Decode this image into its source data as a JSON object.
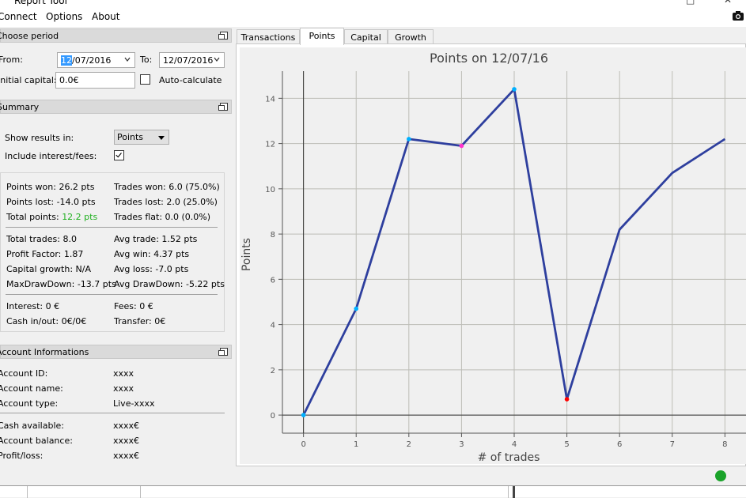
{
  "window": {
    "title": "Report Tool"
  },
  "menu": {
    "items": [
      "Connect",
      "Options",
      "About"
    ]
  },
  "period": {
    "header": "Choose period",
    "from_label": "From:",
    "from_day": "12",
    "from_rest": "/07/2016",
    "to_label": "To:",
    "to_value": "12/07/2016",
    "initial_capital_label": "Initial capital:",
    "initial_capital_value": "0.0€",
    "auto_calculate_label": "Auto-calculate"
  },
  "summary": {
    "header": "Summary",
    "show_results_label": "Show results in:",
    "show_results_value": "Points",
    "include_fees_label": "Include interest/fees:",
    "include_fees_checked": true,
    "rows": {
      "points_won": "Points won: 26.2 pts",
      "trades_won": "Trades won: 6.0 (75.0%)",
      "points_lost": "Points lost: -14.0 pts",
      "trades_lost": "Trades lost: 2.0 (25.0%)",
      "total_points_label": "Total points:",
      "total_points_value": "12.2 pts",
      "trades_flat": "Trades flat: 0.0 (0.0%)",
      "total_trades": "Total trades: 8.0",
      "avg_trade": "Avg trade: 1.52 pts",
      "profit_factor": "Profit Factor: 1.87",
      "avg_win": "Avg win: 4.37 pts",
      "capital_growth": "Capital growth: N/A",
      "avg_loss": "Avg loss: -7.0 pts",
      "max_drawdown": "MaxDrawDown: -13.7 pts",
      "avg_drawdown": "Avg DrawDown: -5.22 pts",
      "interest": "Interest: 0 €",
      "fees": "Fees: 0 €",
      "cash_inout": "Cash in/out: 0€/0€",
      "transfer": "Transfer: 0€"
    }
  },
  "account": {
    "header": "Account Informations",
    "id_label": "Account ID:",
    "id_value": "xxxx",
    "name_label": "Account name:",
    "name_value": "xxxx",
    "type_label": "Account type:",
    "type_value": "Live-xxxx",
    "cash_label": "Cash available:",
    "cash_value": "xxxx€",
    "balance_label": "Account balance:",
    "balance_value": "xxxx€",
    "pl_label": "Profit/loss:",
    "pl_value": "xxxx€"
  },
  "tabs": [
    "Transactions",
    "Points",
    "Capital",
    "Growth"
  ],
  "active_tab": "Points",
  "colors": {
    "line": "#2e3f9e",
    "total_points_green": "#21b021",
    "status_ok": "#1aa32a"
  },
  "chart_data": {
    "type": "line",
    "title": "Points on 12/07/16",
    "xlabel": "# of trades",
    "ylabel": "Points",
    "x": [
      0,
      1,
      2,
      3,
      4,
      5,
      6,
      7,
      8
    ],
    "series": [
      {
        "values": [
          0,
          4.7,
          12.2,
          11.9,
          14.4,
          0.7,
          8.2,
          10.7,
          12.2
        ]
      }
    ],
    "point_markers": [
      {
        "x": 0,
        "color": "#00b0ff"
      },
      {
        "x": 1,
        "color": "#00b0ff"
      },
      {
        "x": 2,
        "color": "#00b0ff"
      },
      {
        "x": 3,
        "color": "#ff33cc"
      },
      {
        "x": 4,
        "color": "#00b0ff"
      },
      {
        "x": 5,
        "color": "#ff0000"
      }
    ],
    "xticks": [
      "0",
      "1",
      "2",
      "3",
      "4",
      "5",
      "6",
      "7",
      "8"
    ],
    "yticks": [
      "0",
      "2",
      "4",
      "6",
      "8",
      "10",
      "12",
      "14"
    ],
    "xlim": [
      -0.4,
      8.4
    ],
    "ylim": [
      -0.8,
      15.2
    ],
    "grid": true
  }
}
